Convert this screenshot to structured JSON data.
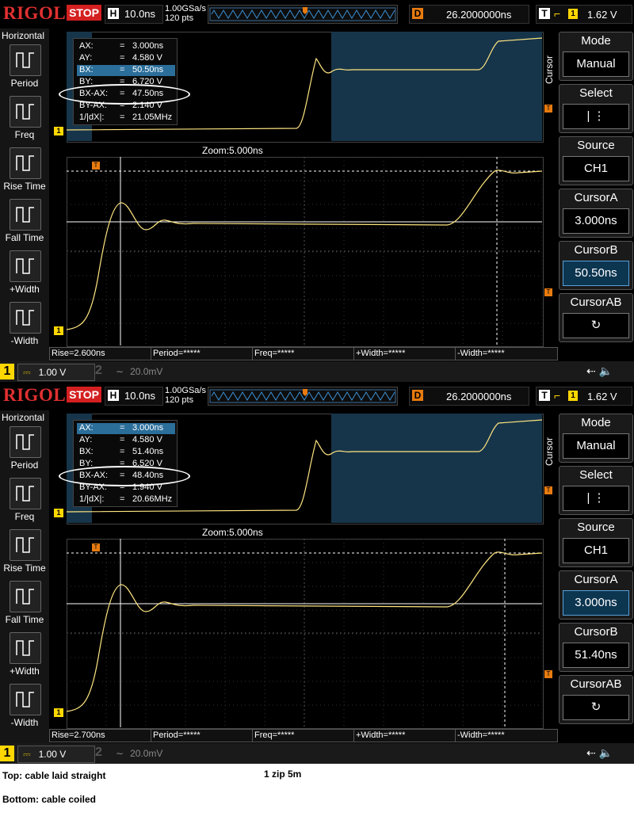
{
  "scopes": [
    {
      "header": {
        "brand": "RIGOL",
        "run_state": "STOP",
        "h_label": "H",
        "timebase": "10.0ns",
        "sample_rate": "1.00GSa/s",
        "points": "120 pts",
        "d_label": "D",
        "delay": "26.2000000ns",
        "t_label": "T",
        "trigger_source": "1",
        "trigger_level": "1.62 V"
      },
      "left_menu": {
        "title": "Horizontal",
        "items": [
          "Period",
          "Freq",
          "Rise Time",
          "Fall Time",
          "+Width",
          "-Width"
        ]
      },
      "right_menu": {
        "title": "Cursor",
        "buttons": [
          {
            "label": "Mode",
            "value": "Manual"
          },
          {
            "label": "Select",
            "value": "|  ⋮"
          },
          {
            "label": "Source",
            "value": "CH1"
          },
          {
            "label": "CursorA",
            "value": "3.000ns"
          },
          {
            "label": "CursorB",
            "value": "50.50ns"
          },
          {
            "label": "CursorAB",
            "value": "↻"
          }
        ]
      },
      "cursor_readout": [
        {
          "key": "AX:",
          "eq": "=",
          "val": "3.000ns"
        },
        {
          "key": "AY:",
          "eq": "=",
          "val": "4.580 V"
        },
        {
          "key": "BX:",
          "eq": "=",
          "val": "50.50ns"
        },
        {
          "key": "BY:",
          "eq": "=",
          "val": "6.720 V"
        },
        {
          "key": "BX-AX:",
          "eq": "=",
          "val": "47.50ns"
        },
        {
          "key": "BY-AX:",
          "eq": "=",
          "val": "2.140 V"
        },
        {
          "key": "1/|dX|:",
          "eq": "=",
          "val": "21.05MHz"
        }
      ],
      "zoom_label": "Zoom:5.000ns",
      "measurements": [
        "Rise=2.600ns",
        "Period=*****",
        "Freq=*****",
        "+Width=*****",
        "-Width=*****"
      ],
      "status": {
        "ch1": "1",
        "ch1_scale": "1.00 V",
        "ch2": "2",
        "ch2_scale": "20.0mV"
      }
    },
    {
      "header": {
        "brand": "RIGOL",
        "run_state": "STOP",
        "h_label": "H",
        "timebase": "10.0ns",
        "sample_rate": "1.00GSa/s",
        "points": "120 pts",
        "d_label": "D",
        "delay": "26.2000000ns",
        "t_label": "T",
        "trigger_source": "1",
        "trigger_level": "1.62 V"
      },
      "left_menu": {
        "title": "Horizontal",
        "items": [
          "Period",
          "Freq",
          "Rise Time",
          "Fall Time",
          "+Width",
          "-Width"
        ]
      },
      "right_menu": {
        "title": "Cursor",
        "buttons": [
          {
            "label": "Mode",
            "value": "Manual"
          },
          {
            "label": "Select",
            "value": "|  ⋮"
          },
          {
            "label": "Source",
            "value": "CH1"
          },
          {
            "label": "CursorA",
            "value": "3.000ns"
          },
          {
            "label": "CursorB",
            "value": "51.40ns"
          },
          {
            "label": "CursorAB",
            "value": "↻"
          }
        ]
      },
      "cursor_readout": [
        {
          "key": "AX:",
          "eq": "=",
          "val": "3.000ns"
        },
        {
          "key": "AY:",
          "eq": "=",
          "val": "4.580 V"
        },
        {
          "key": "BX:",
          "eq": "=",
          "val": "51.40ns"
        },
        {
          "key": "BY:",
          "eq": "=",
          "val": "6.520 V"
        },
        {
          "key": "BX-AX:",
          "eq": "=",
          "val": "48.40ns"
        },
        {
          "key": "BY-AX:",
          "eq": "=",
          "val": "1.940 V"
        },
        {
          "key": "1/|dX|:",
          "eq": "=",
          "val": "20.66MHz"
        }
      ],
      "zoom_label": "Zoom:5.000ns",
      "measurements": [
        "Rise=2.700ns",
        "Period=*****",
        "Freq=*****",
        "+Width=*****",
        "-Width=*****"
      ],
      "status": {
        "ch1": "1",
        "ch1_scale": "1.00 V",
        "ch2": "2",
        "ch2_scale": "20.0mV"
      }
    }
  ],
  "captions": {
    "top": "Top: cable laid straight",
    "middle": "1 zip 5m",
    "bottom": "Bottom: cable coiled"
  },
  "colors": {
    "trace": "#ffe680",
    "brand": "#e03030",
    "accent": "#e87b10",
    "highlight": "#2b6e9a"
  }
}
